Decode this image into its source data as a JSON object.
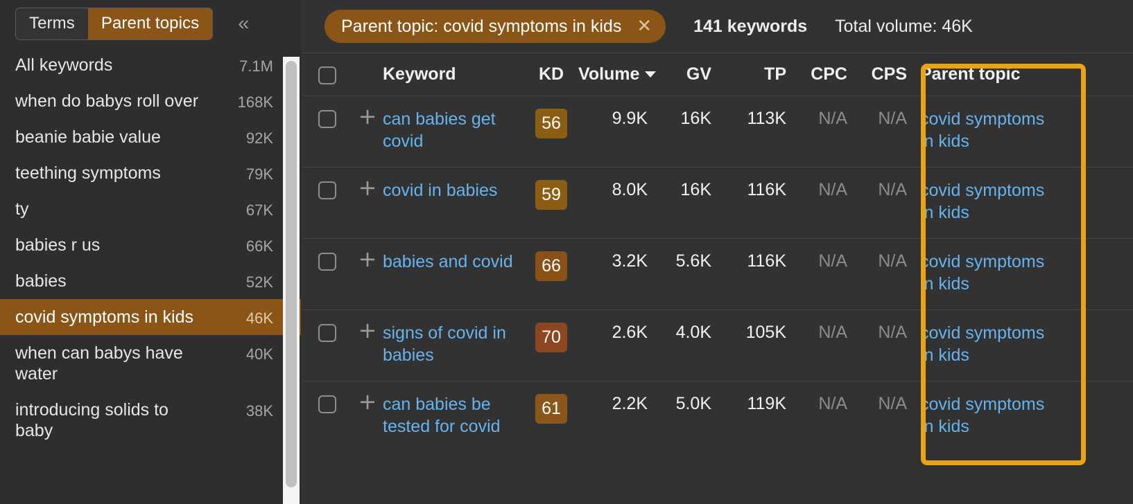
{
  "sidebar": {
    "toggle": {
      "terms_label": "Terms",
      "parent_topics_label": "Parent topics",
      "active": "Parent topics"
    },
    "collapse_icon": "chevron-double-left-icon",
    "items": [
      {
        "label": "All keywords",
        "volume": "7.1M",
        "selected": false
      },
      {
        "label": "when do babys roll over",
        "volume": "168K",
        "selected": false
      },
      {
        "label": "beanie babie value",
        "volume": "92K",
        "selected": false
      },
      {
        "label": "teething symptoms",
        "volume": "79K",
        "selected": false
      },
      {
        "label": "ty",
        "volume": "67K",
        "selected": false
      },
      {
        "label": "babies r us",
        "volume": "66K",
        "selected": false
      },
      {
        "label": "babies",
        "volume": "52K",
        "selected": false
      },
      {
        "label": "covid symptoms in kids",
        "volume": "46K",
        "selected": true
      },
      {
        "label": "when can babys have water",
        "volume": "40K",
        "selected": false
      },
      {
        "label": "introducing solids to baby",
        "volume": "38K",
        "selected": false
      }
    ]
  },
  "header": {
    "chip_label": "Parent topic: covid symptoms in kids",
    "chip_close_icon": "close-icon",
    "keyword_count": "141 keywords",
    "total_volume": "Total volume: 46K"
  },
  "table": {
    "columns": {
      "keyword": "Keyword",
      "kd": "KD",
      "volume": "Volume",
      "gv": "GV",
      "tp": "TP",
      "cpc": "CPC",
      "cps": "CPS",
      "parent_topic": "Parent topic"
    },
    "sort_icon": "caret-down-icon",
    "select_all_icon": "checkbox-icon",
    "rows": [
      {
        "keyword": "can babies get covid",
        "kd": "56",
        "kd_color": "#8c5e14",
        "volume": "9.9K",
        "gv": "16K",
        "tp": "113K",
        "cpc": "N/A",
        "cps": "N/A",
        "parent_topic": "covid symptoms in kids"
      },
      {
        "keyword": "covid in babies",
        "kd": "59",
        "kd_color": "#8c5e14",
        "volume": "8.0K",
        "gv": "16K",
        "tp": "116K",
        "cpc": "N/A",
        "cps": "N/A",
        "parent_topic": "covid symptoms in kids"
      },
      {
        "keyword": "babies and covid",
        "kd": "66",
        "kd_color": "#8a5116",
        "volume": "3.2K",
        "gv": "5.6K",
        "tp": "116K",
        "cpc": "N/A",
        "cps": "N/A",
        "parent_topic": "covid symptoms in kids"
      },
      {
        "keyword": "signs of covid in babies",
        "kd": "70",
        "kd_color": "#8c4620",
        "volume": "2.6K",
        "gv": "4.0K",
        "tp": "105K",
        "cpc": "N/A",
        "cps": "N/A",
        "parent_topic": "covid symptoms in kids"
      },
      {
        "keyword": "can babies be tested for covid",
        "kd": "61",
        "kd_color": "#8b561a",
        "volume": "2.2K",
        "gv": "5.0K",
        "tp": "119K",
        "cpc": "N/A",
        "cps": "N/A",
        "parent_topic": "covid symptoms in kids"
      }
    ]
  },
  "colors": {
    "accent_orange": "#8a5517",
    "highlight_border": "#e8a317",
    "link_blue": "#66b3ee",
    "background": "#323232",
    "sidebar_background": "#2e2e2e"
  }
}
